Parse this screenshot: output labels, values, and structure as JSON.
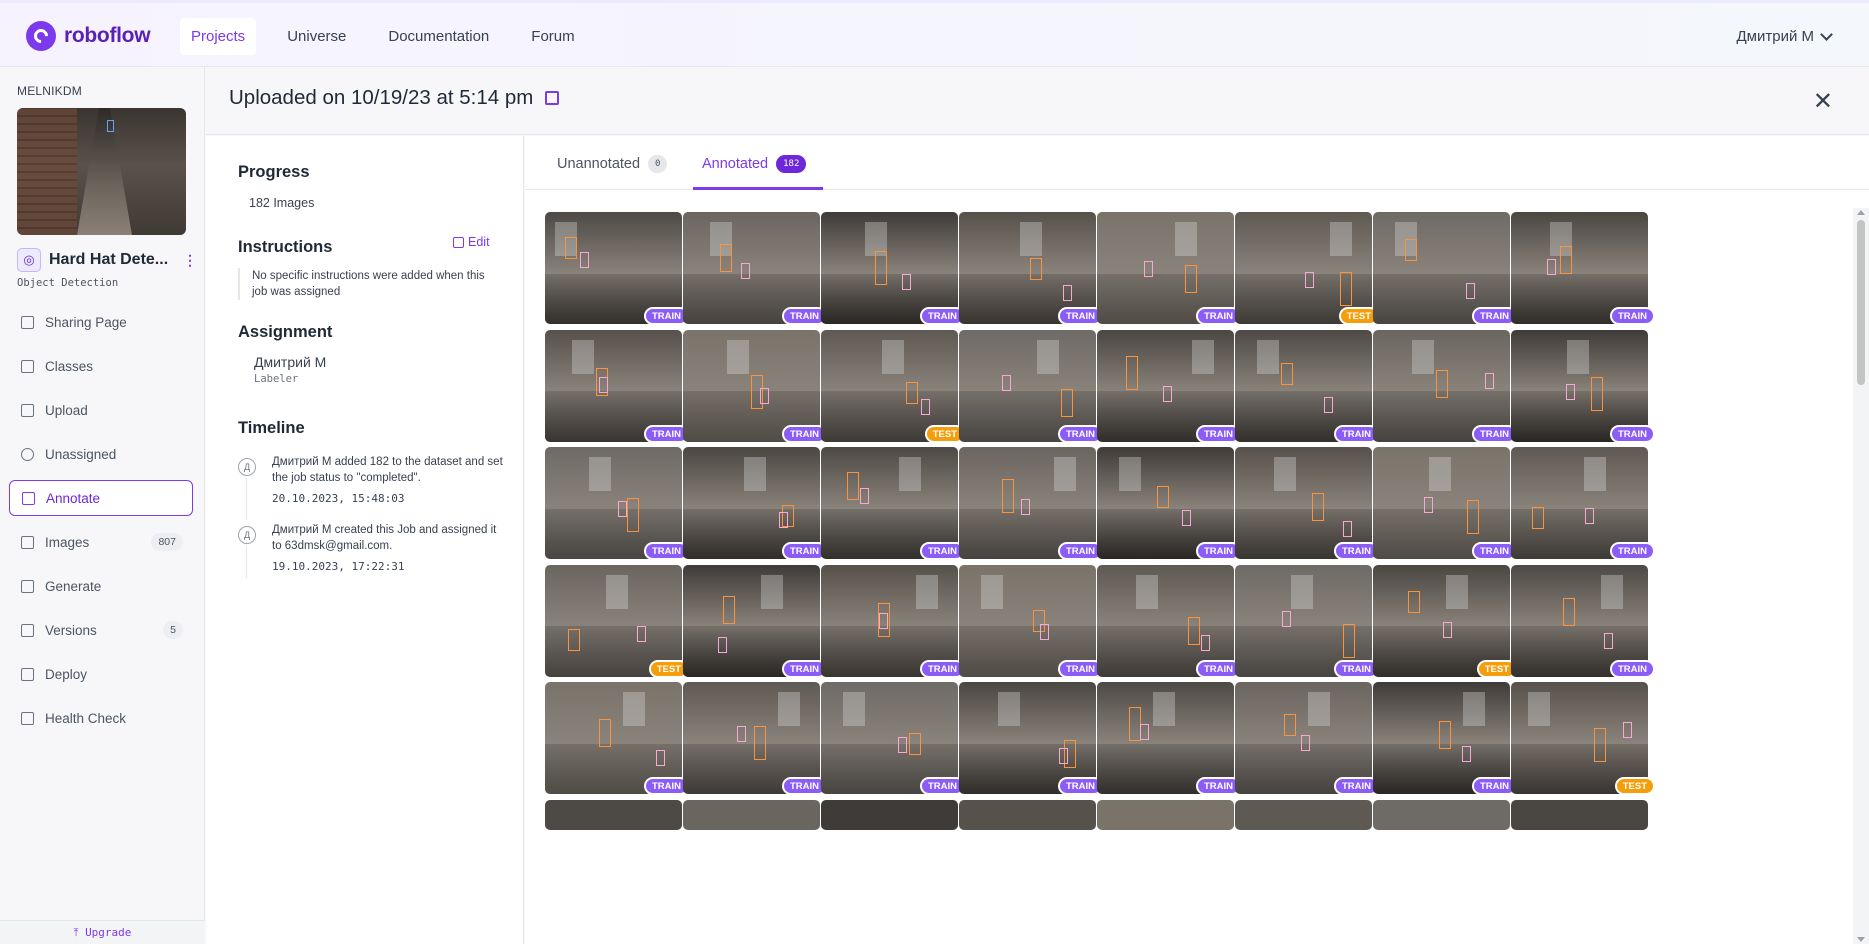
{
  "app": {
    "name": "roboflow"
  },
  "nav": {
    "items": [
      {
        "label": "Projects",
        "active": true
      },
      {
        "label": "Universe",
        "active": false
      },
      {
        "label": "Documentation",
        "active": false
      },
      {
        "label": "Forum",
        "active": false
      }
    ],
    "user": "Дмитрий М"
  },
  "sidebar": {
    "workspace": "MELNIKDM",
    "project_name": "Hard Hat Dete...",
    "project_type": "Object Detection",
    "items": [
      {
        "label": "Sharing Page",
        "icon": "document-icon"
      },
      {
        "label": "Classes",
        "icon": "list-icon"
      },
      {
        "label": "Upload",
        "icon": "arrow-up-icon"
      },
      {
        "label": "Unassigned",
        "icon": "search-icon"
      },
      {
        "label": "Annotate",
        "icon": "annotate-icon",
        "active": true
      },
      {
        "label": "Images",
        "icon": "images-icon",
        "count": "807"
      },
      {
        "label": "Generate",
        "icon": "generate-icon"
      },
      {
        "label": "Versions",
        "icon": "versions-icon",
        "count": "5"
      },
      {
        "label": "Deploy",
        "icon": "rocket-icon"
      },
      {
        "label": "Health Check",
        "icon": "heart-icon"
      }
    ],
    "upgrade": "Upgrade"
  },
  "page": {
    "title": "Uploaded on 10/19/23 at 5:14 pm"
  },
  "panel": {
    "progress_heading": "Progress",
    "progress_text": "182 Images",
    "instructions_heading": "Instructions",
    "edit_label": "Edit",
    "instructions_text": "No specific instructions were added when this job was assigned",
    "assignment_heading": "Assignment",
    "assignee": "Дмитрий М",
    "assignee_role": "Labeler",
    "timeline_heading": "Timeline",
    "timeline": [
      {
        "text": "Дмитрий М added 182 to the dataset and set the job status to \"completed\".",
        "time": "20.10.2023, 15:48:03",
        "avatar": "Д"
      },
      {
        "text": "Дмитрий М created this Job and assigned it to 63dmsk@gmail.com.",
        "time": "19.10.2023, 17:22:31",
        "avatar": "Д"
      }
    ]
  },
  "tabs": {
    "unannotated": {
      "label": "Unannotated",
      "count": "0"
    },
    "annotated": {
      "label": "Annotated",
      "count": "182"
    }
  },
  "grid": {
    "splits": [
      [
        "TRAIN",
        "TRAIN",
        "TRAIN",
        "TRAIN",
        "TRAIN",
        "TEST",
        "TRAIN",
        "TRAIN"
      ],
      [
        "TRAIN",
        "TRAIN",
        "TEST",
        "TRAIN",
        "TRAIN",
        "TRAIN",
        "TRAIN",
        "TRAIN"
      ],
      [
        "TRAIN",
        "TRAIN",
        "TRAIN",
        "TRAIN",
        "TRAIN",
        "TRAIN",
        "TRAIN",
        "TRAIN"
      ],
      [
        "TEST",
        "TRAIN",
        "TRAIN",
        "TRAIN",
        "TRAIN",
        "TRAIN",
        "TEST",
        "TRAIN"
      ],
      [
        "TRAIN",
        "TRAIN",
        "TRAIN",
        "TRAIN",
        "TRAIN",
        "TRAIN",
        "TRAIN",
        "TEST"
      ]
    ]
  },
  "colors": {
    "accent": "#7c3aed",
    "train_badge": "#8b5cf6",
    "test_badge": "#f59e0b"
  }
}
